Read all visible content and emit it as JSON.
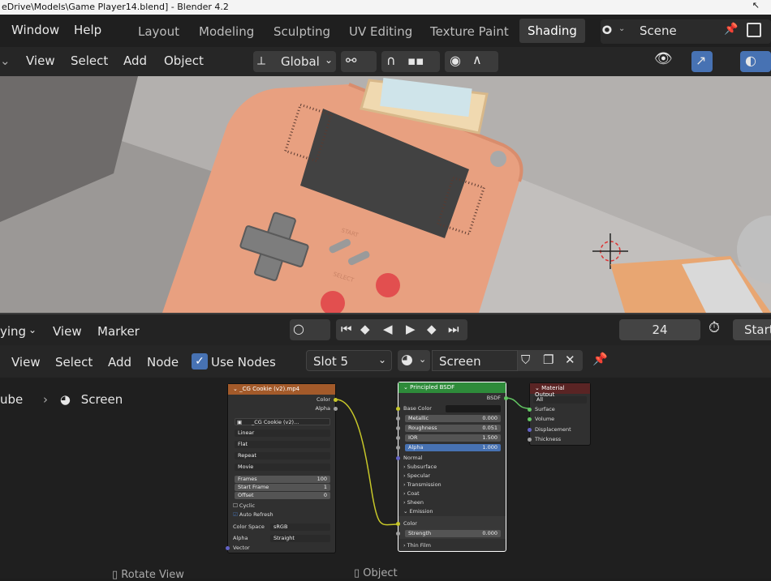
{
  "title_bar": "eDrive\\Models\\Game Player14.blend] - Blender 4.2",
  "top_menu": {
    "window": "Window",
    "help": "Help"
  },
  "workspace_tabs": [
    "Layout",
    "Modeling",
    "Sculpting",
    "UV Editing",
    "Texture Paint",
    "Shading"
  ],
  "active_workspace": "Shading",
  "scene_name": "Scene",
  "viewport_header": {
    "view": "View",
    "select": "Select",
    "add": "Add",
    "object": "Object",
    "transform_orientation": "Global"
  },
  "viewport_labels": {
    "start": "START",
    "select": "SELECT"
  },
  "timeline": {
    "mode": "ying",
    "view": "View",
    "marker": "Marker",
    "current_frame": "24",
    "start_label": "Start"
  },
  "node_editor_header": {
    "view": "View",
    "select": "Select",
    "add": "Add",
    "node": "Node",
    "use_nodes": "Use Nodes",
    "slot": "Slot 5",
    "material": "Screen"
  },
  "breadcrumb": {
    "object": "ube",
    "material": "Screen"
  },
  "image_node": {
    "title": "_CG Cookie (v2).mp4",
    "out_color": "Color",
    "out_alpha": "Alpha",
    "image_name": "_CG Cookie (v2)...",
    "interpolation": "Linear",
    "projection": "Flat",
    "extension": "Repeat",
    "source": "Movie",
    "frames_label": "Frames",
    "frames": "100",
    "start_frame_label": "Start Frame",
    "start_frame": "1",
    "offset_label": "Offset",
    "offset": "0",
    "cyclic": "Cyclic",
    "auto_refresh": "Auto Refresh",
    "color_space_label": "Color Space",
    "color_space": "sRGB",
    "alpha_label": "Alpha",
    "alpha_mode": "Straight",
    "vector": "Vector"
  },
  "bsdf_node": {
    "title": "Principled BSDF",
    "out": "BSDF",
    "base_color": "Base Color",
    "metallic_label": "Metallic",
    "metallic": "0.000",
    "roughness_label": "Roughness",
    "roughness": "0.051",
    "ior_label": "IOR",
    "ior": "1.500",
    "alpha_label": "Alpha",
    "alpha": "1.000",
    "normal": "Normal",
    "panels": [
      "Subsurface",
      "Specular",
      "Transmission",
      "Coat",
      "Sheen",
      "Emission"
    ],
    "emission_color": "Color",
    "strength_label": "Strength",
    "strength": "0.000",
    "thin_film": "Thin Film"
  },
  "output_node": {
    "title": "Material Output",
    "target": "All",
    "surface": "Surface",
    "volume": "Volume",
    "displacement": "Displacement",
    "thickness": "Thickness"
  },
  "bottom_hints": {
    "rotate": "Rotate View",
    "object": "Object"
  },
  "colors": {
    "accent": "#4772b3",
    "image_header": "#a35a2a",
    "shader_header": "#2e8b3a",
    "output_header": "#5a2424",
    "socket_yellow": "#c7c729",
    "socket_grey": "#a1a1a1",
    "socket_green": "#63c763",
    "socket_purple": "#6363c7"
  }
}
